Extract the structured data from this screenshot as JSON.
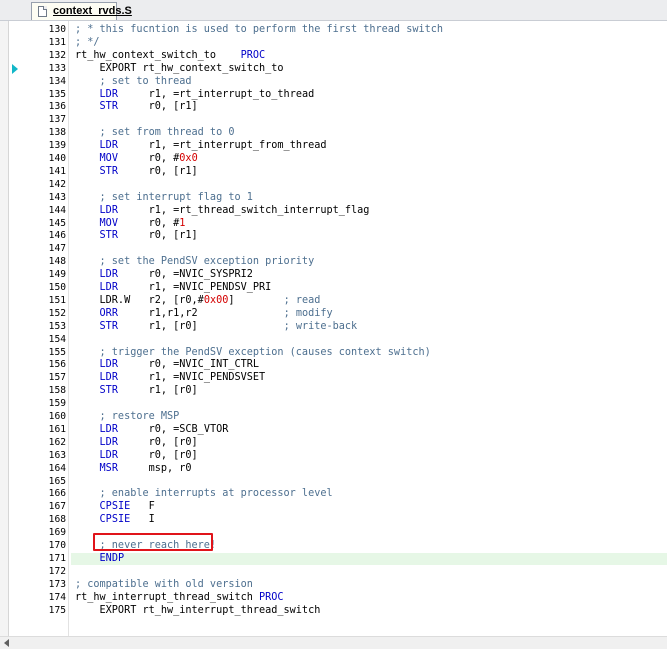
{
  "tab": {
    "filename": "context_rvds.S"
  },
  "lines": [
    {
      "n": "130",
      "parts": [
        {
          "t": "; * this fucntion is used to perform the first thread switch",
          "c": "cm"
        }
      ]
    },
    {
      "n": "131",
      "parts": [
        {
          "t": "; */",
          "c": "cm"
        }
      ]
    },
    {
      "n": "132",
      "parts": [
        {
          "t": "rt_hw_context_switch_to    ",
          "c": ""
        },
        {
          "t": "PROC",
          "c": "kw"
        }
      ]
    },
    {
      "n": "133",
      "parts": [
        {
          "t": "    EXPORT rt_hw_context_switch_to",
          "c": ""
        }
      ]
    },
    {
      "n": "134",
      "parts": [
        {
          "t": "    ; set to thread",
          "c": "cm"
        }
      ]
    },
    {
      "n": "135",
      "parts": [
        {
          "t": "    ",
          "c": ""
        },
        {
          "t": "LDR",
          "c": "kw"
        },
        {
          "t": "     r1, =rt_interrupt_to_thread",
          "c": ""
        }
      ]
    },
    {
      "n": "136",
      "parts": [
        {
          "t": "    ",
          "c": ""
        },
        {
          "t": "STR",
          "c": "kw"
        },
        {
          "t": "     r0, [r1]",
          "c": ""
        }
      ]
    },
    {
      "n": "137",
      "parts": []
    },
    {
      "n": "138",
      "parts": [
        {
          "t": "    ; set from thread to 0",
          "c": "cm"
        }
      ]
    },
    {
      "n": "139",
      "parts": [
        {
          "t": "    ",
          "c": ""
        },
        {
          "t": "LDR",
          "c": "kw"
        },
        {
          "t": "     r1, =rt_interrupt_from_thread",
          "c": ""
        }
      ]
    },
    {
      "n": "140",
      "parts": [
        {
          "t": "    ",
          "c": ""
        },
        {
          "t": "MOV",
          "c": "kw"
        },
        {
          "t": "     r0, #",
          "c": ""
        },
        {
          "t": "0x0",
          "c": "nb"
        }
      ]
    },
    {
      "n": "141",
      "parts": [
        {
          "t": "    ",
          "c": ""
        },
        {
          "t": "STR",
          "c": "kw"
        },
        {
          "t": "     r0, [r1]",
          "c": ""
        }
      ]
    },
    {
      "n": "142",
      "parts": []
    },
    {
      "n": "143",
      "parts": [
        {
          "t": "    ; set interrupt flag to 1",
          "c": "cm"
        }
      ]
    },
    {
      "n": "144",
      "parts": [
        {
          "t": "    ",
          "c": ""
        },
        {
          "t": "LDR",
          "c": "kw"
        },
        {
          "t": "     r1, =rt_thread_switch_interrupt_flag",
          "c": ""
        }
      ]
    },
    {
      "n": "145",
      "parts": [
        {
          "t": "    ",
          "c": ""
        },
        {
          "t": "MOV",
          "c": "kw"
        },
        {
          "t": "     r0, #",
          "c": ""
        },
        {
          "t": "1",
          "c": "nb"
        }
      ]
    },
    {
      "n": "146",
      "parts": [
        {
          "t": "    ",
          "c": ""
        },
        {
          "t": "STR",
          "c": "kw"
        },
        {
          "t": "     r0, [r1]",
          "c": ""
        }
      ]
    },
    {
      "n": "147",
      "parts": []
    },
    {
      "n": "148",
      "parts": [
        {
          "t": "    ; set the PendSV exception priority",
          "c": "cm"
        }
      ]
    },
    {
      "n": "149",
      "parts": [
        {
          "t": "    ",
          "c": ""
        },
        {
          "t": "LDR",
          "c": "kw"
        },
        {
          "t": "     r0, =NVIC_SYSPRI2",
          "c": ""
        }
      ]
    },
    {
      "n": "150",
      "parts": [
        {
          "t": "    ",
          "c": ""
        },
        {
          "t": "LDR",
          "c": "kw"
        },
        {
          "t": "     r1, =NVIC_PENDSV_PRI",
          "c": ""
        }
      ]
    },
    {
      "n": "151",
      "parts": [
        {
          "t": "    LDR.W   r2, [r0,#",
          "c": ""
        },
        {
          "t": "0x00",
          "c": "nb"
        },
        {
          "t": "]        ",
          "c": ""
        },
        {
          "t": "; read",
          "c": "cm"
        }
      ]
    },
    {
      "n": "152",
      "parts": [
        {
          "t": "    ",
          "c": ""
        },
        {
          "t": "ORR",
          "c": "kw"
        },
        {
          "t": "     r1,r1,r2              ",
          "c": ""
        },
        {
          "t": "; modify",
          "c": "cm"
        }
      ]
    },
    {
      "n": "153",
      "parts": [
        {
          "t": "    ",
          "c": ""
        },
        {
          "t": "STR",
          "c": "kw"
        },
        {
          "t": "     r1, [r0]              ",
          "c": ""
        },
        {
          "t": "; write-back",
          "c": "cm"
        }
      ]
    },
    {
      "n": "154",
      "parts": []
    },
    {
      "n": "155",
      "parts": [
        {
          "t": "    ; trigger the PendSV exception (causes context switch)",
          "c": "cm"
        }
      ]
    },
    {
      "n": "156",
      "parts": [
        {
          "t": "    ",
          "c": ""
        },
        {
          "t": "LDR",
          "c": "kw"
        },
        {
          "t": "     r0, =NVIC_INT_CTRL",
          "c": ""
        }
      ]
    },
    {
      "n": "157",
      "parts": [
        {
          "t": "    ",
          "c": ""
        },
        {
          "t": "LDR",
          "c": "kw"
        },
        {
          "t": "     r1, =NVIC_PENDSVSET",
          "c": ""
        }
      ]
    },
    {
      "n": "158",
      "parts": [
        {
          "t": "    ",
          "c": ""
        },
        {
          "t": "STR",
          "c": "kw"
        },
        {
          "t": "     r1, [r0]",
          "c": ""
        }
      ]
    },
    {
      "n": "159",
      "parts": []
    },
    {
      "n": "160",
      "parts": [
        {
          "t": "    ; restore MSP",
          "c": "cm"
        }
      ]
    },
    {
      "n": "161",
      "parts": [
        {
          "t": "    ",
          "c": ""
        },
        {
          "t": "LDR",
          "c": "kw"
        },
        {
          "t": "     r0, =SCB_VTOR",
          "c": ""
        }
      ]
    },
    {
      "n": "162",
      "parts": [
        {
          "t": "    ",
          "c": ""
        },
        {
          "t": "LDR",
          "c": "kw"
        },
        {
          "t": "     r0, [r0]",
          "c": ""
        }
      ]
    },
    {
      "n": "163",
      "parts": [
        {
          "t": "    ",
          "c": ""
        },
        {
          "t": "LDR",
          "c": "kw"
        },
        {
          "t": "     r0, [r0]",
          "c": ""
        }
      ]
    },
    {
      "n": "164",
      "parts": [
        {
          "t": "    ",
          "c": ""
        },
        {
          "t": "MSR",
          "c": "kw"
        },
        {
          "t": "     msp, r0",
          "c": ""
        }
      ]
    },
    {
      "n": "165",
      "parts": []
    },
    {
      "n": "166",
      "parts": [
        {
          "t": "    ; enable interrupts at processor level",
          "c": "cm"
        }
      ]
    },
    {
      "n": "167",
      "parts": [
        {
          "t": "    ",
          "c": ""
        },
        {
          "t": "CPSIE",
          "c": "kw"
        },
        {
          "t": "   F",
          "c": ""
        }
      ]
    },
    {
      "n": "168",
      "parts": [
        {
          "t": "    ",
          "c": ""
        },
        {
          "t": "CPSIE",
          "c": "kw"
        },
        {
          "t": "   I",
          "c": ""
        }
      ]
    },
    {
      "n": "169",
      "parts": []
    },
    {
      "n": "170",
      "parts": [
        {
          "t": "    ; never reach here!",
          "c": "cm"
        }
      ]
    },
    {
      "n": "171",
      "hl": true,
      "parts": [
        {
          "t": "    ",
          "c": ""
        },
        {
          "t": "ENDP",
          "c": "kw"
        }
      ]
    },
    {
      "n": "172",
      "parts": []
    },
    {
      "n": "173",
      "parts": [
        {
          "t": "; compatible with old version",
          "c": "cm"
        }
      ]
    },
    {
      "n": "174",
      "parts": [
        {
          "t": "rt_hw_interrupt_thread_switch ",
          "c": ""
        },
        {
          "t": "PROC",
          "c": "kw"
        }
      ]
    },
    {
      "n": "175",
      "parts": [
        {
          "t": "    EXPORT rt_hw_interrupt_thread_switch",
          "c": ""
        }
      ]
    }
  ],
  "colors": {
    "comment": "#4d6f8f",
    "keyword": "#0000c8",
    "number": "#d40000",
    "highlight_box": "#e0141a",
    "current_line": "#e6f7e6",
    "exec_marker": "#12b7c8"
  },
  "icons": {
    "tab_icon": "file-icon",
    "gutter_marker": "execution-arrow-icon",
    "scroll_left": "scroll-left-arrow-icon"
  }
}
